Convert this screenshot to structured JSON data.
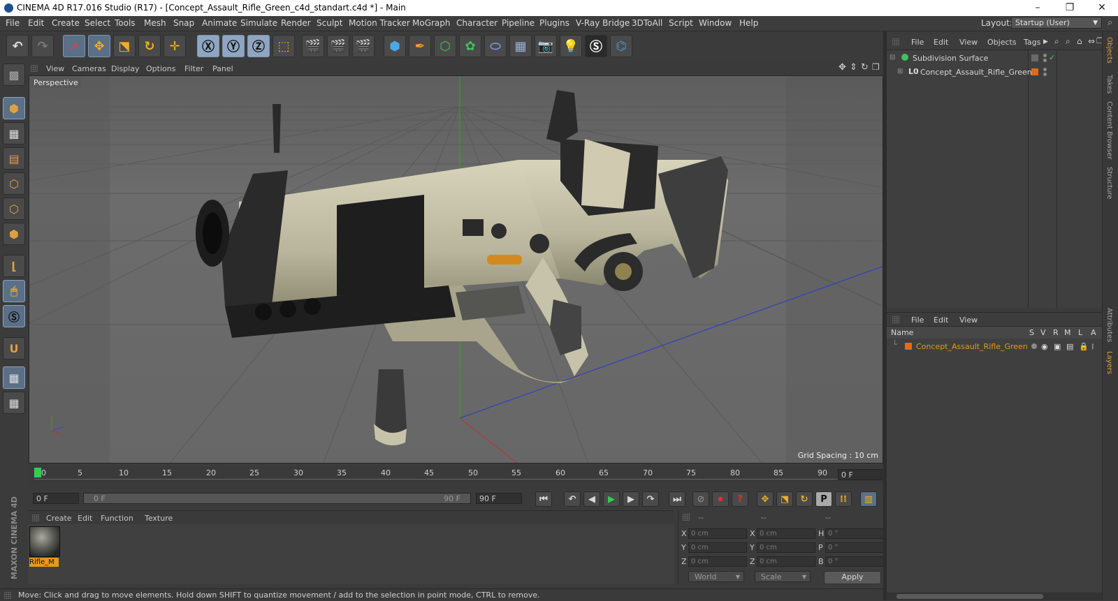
{
  "window": {
    "title": "CINEMA 4D R17.016 Studio (R17) - [Concept_Assault_Rifle_Green_c4d_standart.c4d *] - Main",
    "controls": [
      "–",
      "❐",
      "✕"
    ]
  },
  "menu": [
    "File",
    "Edit",
    "Create",
    "Select",
    "Tools",
    "Mesh",
    "Snap",
    "Animate",
    "Simulate",
    "Render",
    "Sculpt",
    "Motion Tracker",
    "MoGraph",
    "Character",
    "Pipeline",
    "Plugins",
    "V-Ray Bridge",
    "3DToAll",
    "Script",
    "Window",
    "Help"
  ],
  "layout": {
    "label": "Layout:",
    "value": "Startup (User)"
  },
  "viewport": {
    "menu": [
      "View",
      "Cameras",
      "Display",
      "Options",
      "Filter",
      "Panel"
    ],
    "label": "Perspective",
    "grid_spacing": "Grid Spacing : 10 cm"
  },
  "timeline": {
    "ticks": [
      "0",
      "5",
      "10",
      "15",
      "20",
      "25",
      "30",
      "35",
      "40",
      "45",
      "50",
      "55",
      "60",
      "65",
      "70",
      "75",
      "80",
      "85",
      "90"
    ],
    "current_frame": "0 F",
    "start_field": "0 F",
    "range_start": "0 F",
    "range_end": "90 F",
    "end_field": "90 F"
  },
  "material_manager": {
    "menu": [
      "Create",
      "Edit",
      "Function",
      "Texture"
    ],
    "materials": [
      {
        "name": "Rifle_M"
      }
    ]
  },
  "brand": "MAXON CINEMA 4D",
  "coordinates": {
    "headers": [
      "--",
      "--",
      "--"
    ],
    "rows": [
      {
        "a1": "X",
        "v1": "0 cm",
        "a2": "X",
        "v2": "0 cm",
        "a3": "H",
        "v3": "0 °"
      },
      {
        "a1": "Y",
        "v1": "0 cm",
        "a2": "Y",
        "v2": "0 cm",
        "a3": "P",
        "v3": "0 °"
      },
      {
        "a1": "Z",
        "v1": "0 cm",
        "a2": "Z",
        "v2": "0 cm",
        "a3": "B",
        "v3": "0 °"
      }
    ],
    "mode": "World",
    "size_mode": "Scale",
    "apply": "Apply"
  },
  "status": "Move: Click and drag to move elements. Hold down SHIFT to quantize movement / add to the selection in point mode, CTRL to remove.",
  "object_manager": {
    "menu": [
      "File",
      "Edit",
      "View",
      "Objects",
      "Tags"
    ],
    "objects": [
      {
        "name": "Subdivision Surface"
      },
      {
        "name": "Concept_Assault_Rifle_Green"
      }
    ]
  },
  "layer_manager": {
    "menu": [
      "File",
      "Edit",
      "View"
    ],
    "columns": [
      "Name",
      "S",
      "V",
      "R",
      "M",
      "L",
      "A"
    ],
    "layers": [
      {
        "name": "Concept_Assault_Rifle_Green"
      }
    ]
  },
  "side_tabs": [
    "Objects",
    "Takes",
    "Content Browser",
    "Structure",
    "Attributes",
    "Layers"
  ],
  "colors": {
    "accent": "#e39a1a",
    "active_tool": "#5b6f86",
    "layer_color": "#e06a1e"
  }
}
